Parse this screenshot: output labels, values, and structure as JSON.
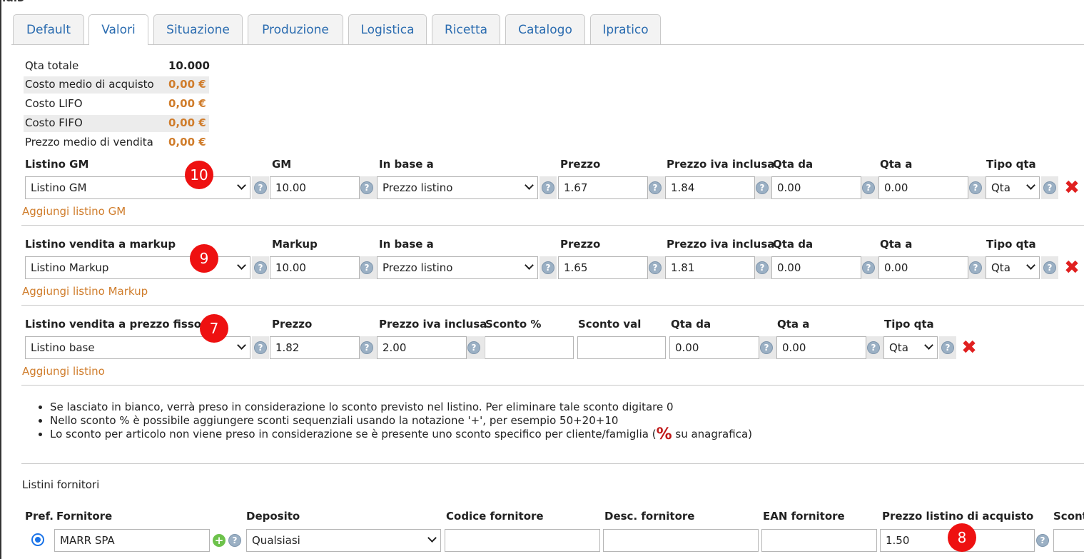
{
  "header": {
    "cut_title": "ldi3"
  },
  "tabs": [
    {
      "label": "Default"
    },
    {
      "label": "Valori"
    },
    {
      "label": "Situazione"
    },
    {
      "label": "Produzione"
    },
    {
      "label": "Logistica"
    },
    {
      "label": "Ricetta"
    },
    {
      "label": "Catalogo"
    },
    {
      "label": "Ipratico"
    }
  ],
  "summary": {
    "qta_totale_label": "Qta totale",
    "qta_totale_value": "10.000",
    "costo_medio_label": "Costo medio di acquisto",
    "costo_medio_value": "0,00 €",
    "costo_lifo_label": "Costo LIFO",
    "costo_lifo_value": "0,00 €",
    "costo_fifo_label": "Costo FIFO",
    "costo_fifo_value": "0,00 €",
    "prezzo_medio_label": "Prezzo medio di vendita",
    "prezzo_medio_value": "0,00 €"
  },
  "gm": {
    "headers": {
      "listino": "Listino GM",
      "gm": "GM",
      "in_base_a": "In base a",
      "prezzo": "Prezzo",
      "prezzo_iva": "Prezzo iva inclusa",
      "qta_da": "Qta da",
      "qta_a": "Qta a",
      "tipo_qta": "Tipo qta"
    },
    "listino": "Listino GM",
    "gm": "10.00",
    "in_base_a": "Prezzo listino",
    "prezzo": "1.67",
    "prezzo_iva": "1.84",
    "qta_da": "0.00",
    "qta_a": "0.00",
    "tipo_qta": "Qta",
    "add_link": "Aggiungi listino GM",
    "badge": "10"
  },
  "markup": {
    "headers": {
      "listino": "Listino vendita a markup",
      "markup": "Markup",
      "in_base_a": "In base a",
      "prezzo": "Prezzo",
      "prezzo_iva": "Prezzo iva inclusa",
      "qta_da": "Qta da",
      "qta_a": "Qta a",
      "tipo_qta": "Tipo qta"
    },
    "listino": "Listino Markup",
    "markup": "10.00",
    "in_base_a": "Prezzo listino",
    "prezzo": "1.65",
    "prezzo_iva": "1.81",
    "qta_da": "0.00",
    "qta_a": "0.00",
    "tipo_qta": "Qta",
    "add_link": "Aggiungi listino Markup",
    "badge": "9"
  },
  "fisso": {
    "headers": {
      "listino": "Listino vendita a prezzo fisso",
      "prezzo": "Prezzo",
      "prezzo_iva": "Prezzo iva inclusa",
      "sconto_pct": "Sconto %",
      "sconto_val": "Sconto val",
      "qta_da": "Qta da",
      "qta_a": "Qta a",
      "tipo_qta": "Tipo qta"
    },
    "listino": "Listino base",
    "prezzo": "1.82",
    "prezzo_iva": "2.00",
    "sconto_pct": "",
    "sconto_val": "",
    "qta_da": "0.00",
    "qta_a": "0.00",
    "tipo_qta": "Qta",
    "add_link": "Aggiungi listino",
    "badge": "7"
  },
  "notes": {
    "n1": "Se lasciato in bianco, verrà preso in considerazione lo sconto previsto nel listino. Per eliminare tale sconto digitare 0",
    "n2": "Nello sconto % è possibile aggiungere sconti sequenziali usando la notazione '+', per esempio 50+20+10",
    "n3a": "Lo sconto per articolo non viene preso in considerazione se è presente uno sconto specifico per cliente/famiglia (",
    "n3icon": "%",
    "n3b": " su anagrafica)"
  },
  "fornitori": {
    "title": "Listini fornitori",
    "headers": {
      "pref": "Pref.",
      "fornitore": "Fornitore",
      "deposito": "Deposito",
      "codice": "Codice fornitore",
      "desc": "Desc. fornitore",
      "ean": "EAN fornitore",
      "prezzo": "Prezzo listino di acquisto",
      "sconto": "Scont"
    },
    "fornitore": "MARR SPA",
    "deposito": "Qualsiasi",
    "codice": "",
    "desc": "",
    "ean": "",
    "prezzo": "1.50",
    "badge": "8"
  },
  "icons": {
    "help": "?",
    "delete": "✖",
    "add": "+"
  }
}
